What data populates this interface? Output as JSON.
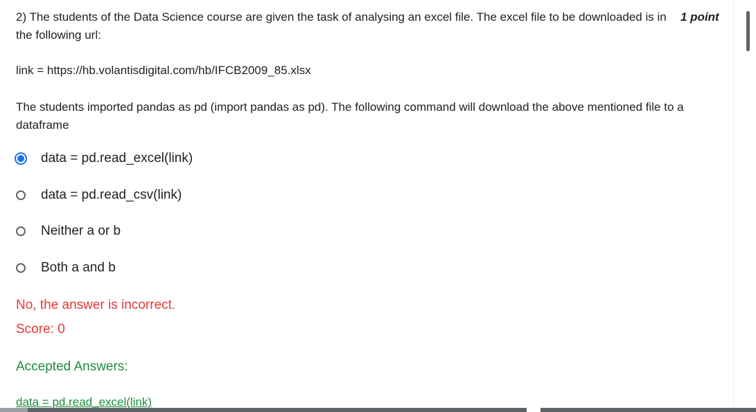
{
  "question": {
    "text": "2) The students of the Data Science course are given the task of analysing an excel file. The excel file to be downloaded is in the following url:",
    "points": "1 point"
  },
  "link_line": "link = https://hb.volantisdigital.com/hb/IFCB2009_85.xlsx",
  "statement": "The students imported pandas as pd (import pandas as pd). The following command will download the above mentioned file to a dataframe",
  "options": [
    {
      "label": "data = pd.read_excel(link)",
      "selected": true
    },
    {
      "label": "data = pd.read_csv(link)",
      "selected": false
    },
    {
      "label": "Neither a or b",
      "selected": false
    },
    {
      "label": "Both a and b",
      "selected": false
    }
  ],
  "feedback": {
    "result": "No, the answer is incorrect.",
    "score": "Score: 0"
  },
  "accepted": {
    "title": "Accepted Answers:",
    "answer": "data = pd.read_excel(link)"
  },
  "colors": {
    "accent": "#1a73e8",
    "error": "#e53935",
    "success": "#1e8e3e"
  }
}
